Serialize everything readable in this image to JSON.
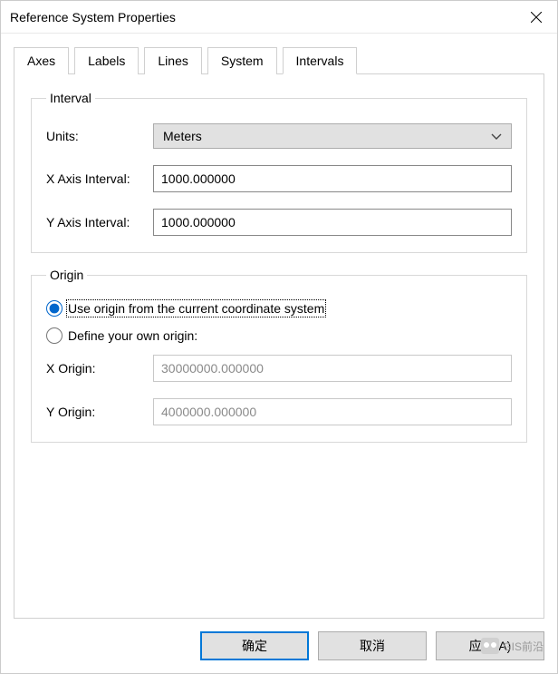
{
  "window": {
    "title": "Reference System Properties"
  },
  "tabs": [
    {
      "label": "Axes"
    },
    {
      "label": "Labels"
    },
    {
      "label": "Lines"
    },
    {
      "label": "System"
    },
    {
      "label": "Intervals"
    }
  ],
  "active_tab": 4,
  "interval": {
    "legend": "Interval",
    "units_label": "Units:",
    "units_value": "Meters",
    "x_interval_label": "X Axis Interval:",
    "x_interval_value": "1000.000000",
    "y_interval_label": "Y Axis Interval:",
    "y_interval_value": "1000.000000"
  },
  "origin": {
    "legend": "Origin",
    "option_current": "Use origin from the current coordinate system",
    "option_define": "Define your own origin:",
    "selected": "current",
    "x_origin_label": "X Origin:",
    "x_origin_value": "30000000.000000",
    "y_origin_label": "Y Origin:",
    "y_origin_value": "4000000.000000"
  },
  "buttons": {
    "ok": "确定",
    "cancel": "取消",
    "apply": "应用(A)"
  },
  "watermark": "GIS前沿"
}
